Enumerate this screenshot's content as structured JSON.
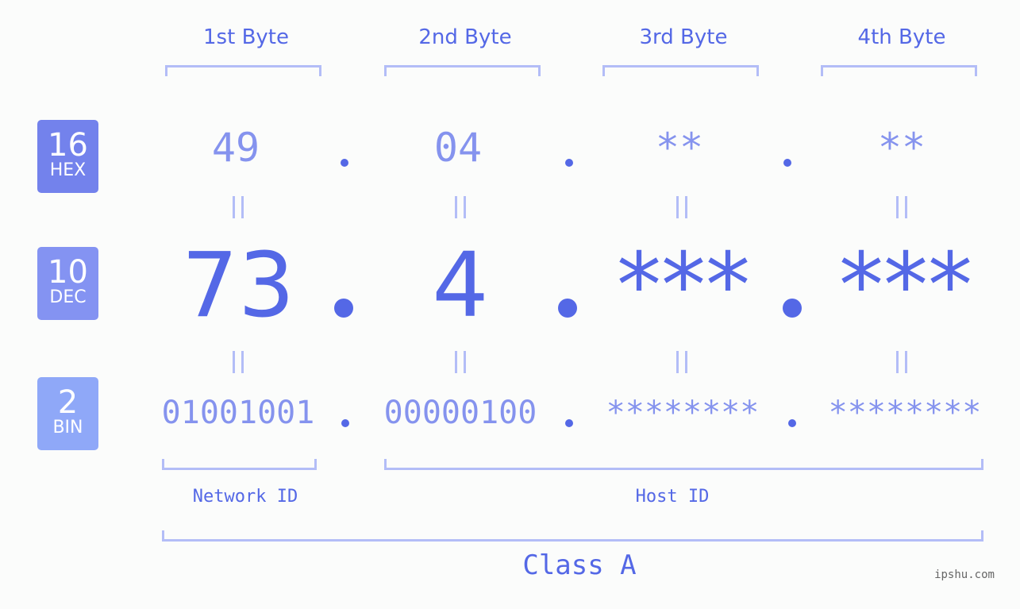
{
  "bytes": [
    {
      "header": "1st Byte",
      "hex": "49",
      "dec": "73",
      "bin": "01001001"
    },
    {
      "header": "2nd Byte",
      "hex": "04",
      "dec": "4",
      "bin": "00000100"
    },
    {
      "header": "3rd Byte",
      "hex": "**",
      "dec": "***",
      "bin": "********"
    },
    {
      "header": "4th Byte",
      "hex": "**",
      "dec": "***",
      "bin": "********"
    }
  ],
  "bases": {
    "hex": {
      "number": "16",
      "label": "HEX",
      "color": "#7382ec"
    },
    "dec": {
      "number": "10",
      "label": "DEC",
      "color": "#8493f2"
    },
    "bin": {
      "number": "2",
      "label": "BIN",
      "color": "#8fa8f8"
    }
  },
  "segments": {
    "network": "Network ID",
    "host": "Host ID",
    "class": "Class A"
  },
  "watermark": "ipshu.com",
  "colors": {
    "accent": "#5468e6",
    "light": "#8593ee",
    "bracket": "#b3bdf7"
  }
}
